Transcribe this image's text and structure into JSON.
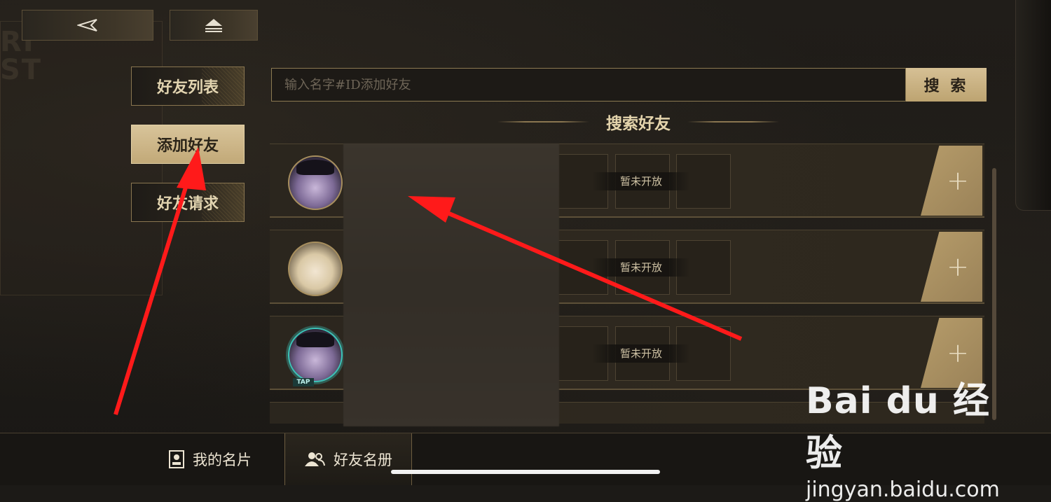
{
  "top_buttons": {
    "back_icon": "back-triangle-icon",
    "home_icon": "eject-icon"
  },
  "side_tabs": [
    {
      "label": "好友列表",
      "active": false
    },
    {
      "label": "添加好友",
      "active": true
    },
    {
      "label": "好友请求",
      "active": false
    }
  ],
  "search": {
    "placeholder": "输入名字#ID添加好友",
    "value": "",
    "button_label": "搜 索"
  },
  "section_title": "搜索好友",
  "results": [
    {
      "status": "暂未开放",
      "avatar": "hat-girl"
    },
    {
      "status": "暂未开放",
      "avatar": "blonde-girl"
    },
    {
      "status": "暂未开放",
      "avatar": "hat-girl-tap",
      "badge": "TAP"
    }
  ],
  "add_symbol": "+",
  "bottom_tabs": [
    {
      "label": "我的名片",
      "icon": "id-card-icon"
    },
    {
      "label": "好友名册",
      "icon": "users-icon",
      "active": true
    }
  ],
  "watermark": {
    "brand": "Bai du 经验",
    "url": "jingyan.baidu.com"
  },
  "background_letters": "RI\nST",
  "colors": {
    "gold": "#c2a978",
    "dark": "#1c1a17",
    "arrow": "#ff1a1a"
  }
}
